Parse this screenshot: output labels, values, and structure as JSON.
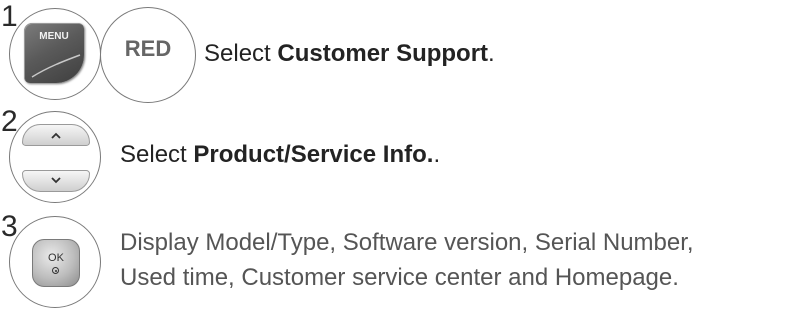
{
  "steps": [
    {
      "number": "1",
      "buttons": {
        "menu_label": "MENU",
        "red_label": "RED"
      },
      "text_prefix": "Select ",
      "text_bold": "Customer Support",
      "text_suffix": "."
    },
    {
      "number": "2",
      "buttons": {
        "up_icon": "chevron-up-icon",
        "down_icon": "chevron-down-icon"
      },
      "text_prefix": "Select ",
      "text_bold": "Product/Service Info.",
      "text_suffix": "."
    },
    {
      "number": "3",
      "buttons": {
        "ok_label": "OK"
      },
      "text_line1": "Display Model/Type, Software version, Serial Number,",
      "text_line2": "Used time, Customer service center and Homepage."
    }
  ]
}
